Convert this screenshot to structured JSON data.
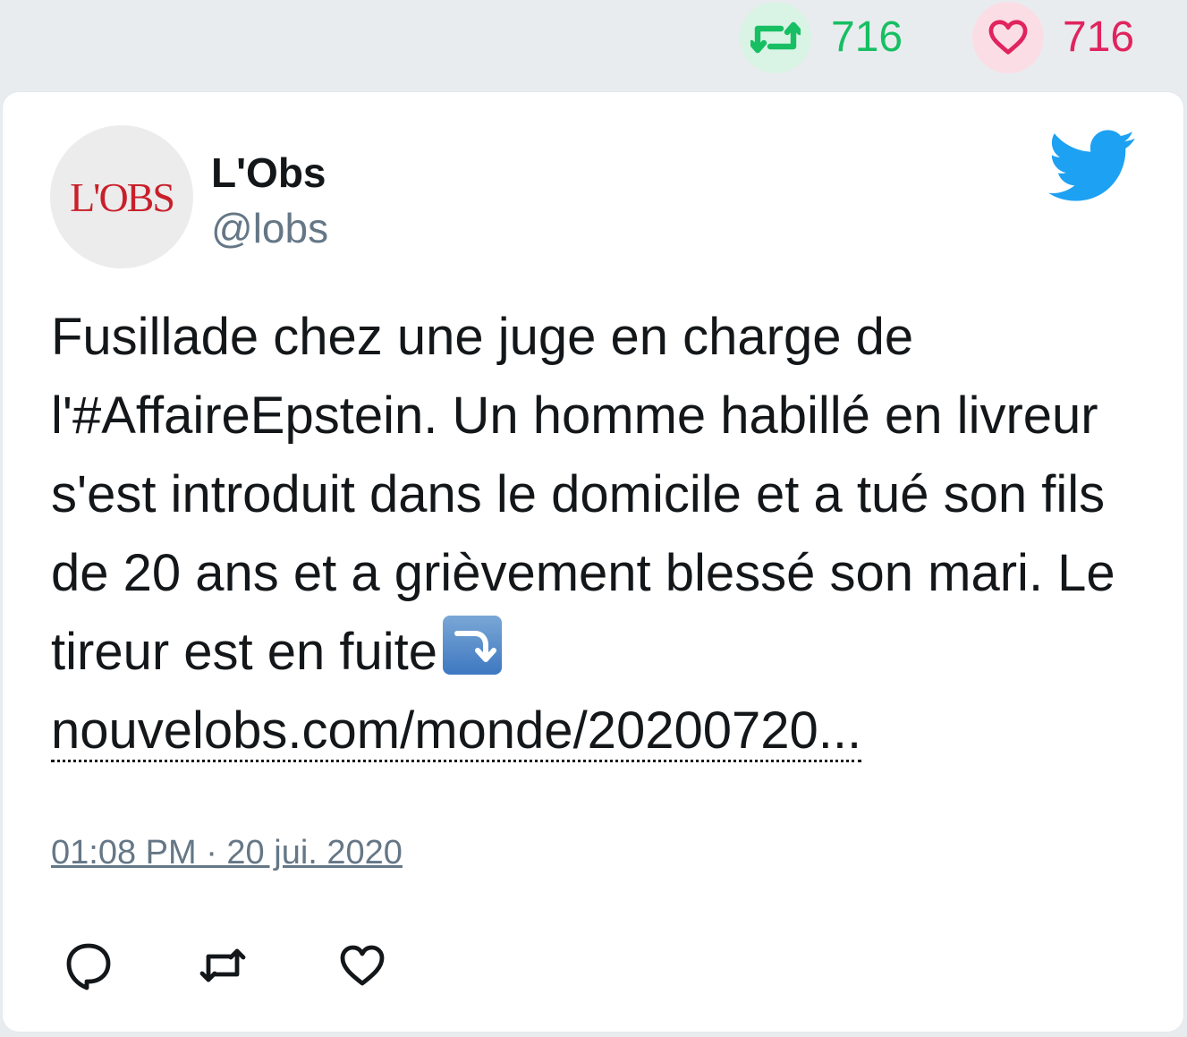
{
  "stats": {
    "retweets": "716",
    "likes": "716"
  },
  "tweet": {
    "avatar_logo": "L'OBS",
    "display_name": "L'Obs",
    "handle": "@lobs",
    "text": "Fusillade chez une juge en charge de l'#AffaireEpstein. Un homme habillé en livreur s'est introduit dans le domicile et a tué son fils de 20 ans et a grièvement blessé son mari. Le tireur est en fuite",
    "emoji": "arrow-curving-down-icon",
    "link": "nouvelobs.com/monde/20200720...",
    "timestamp": "01:08 PM · 20 jui. 2020"
  },
  "colors": {
    "retweet_green": "#17bf63",
    "like_red": "#e0245e",
    "twitter_blue": "#1da1f2",
    "secondary_text": "#657786"
  },
  "icons": {
    "brand": "twitter-bird-icon",
    "actions": [
      "reply-icon",
      "retweet-icon",
      "heart-icon"
    ]
  }
}
